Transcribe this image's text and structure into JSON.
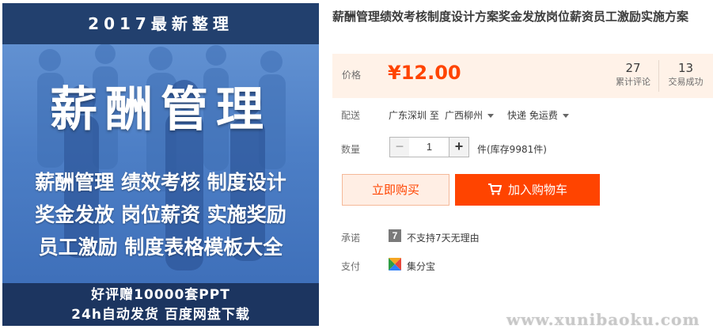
{
  "image": {
    "top_banner": "2017最新整理",
    "main_title": "薪酬管理",
    "lines": [
      "薪酬管理 绩效考核 制度设计",
      "奖金发放 岗位薪资 实施奖励",
      "员工激励 制度表格模板大全"
    ],
    "bottom_line1": "好评赠10000套PPT",
    "bottom_line2": "24h自动发货 百度网盘下载"
  },
  "product": {
    "title": "薪酬管理绩效考核制度设计方案奖金发放岗位薪资员工激励实施方案"
  },
  "price": {
    "label": "价格",
    "value": "¥12.00",
    "reviews_count": "27",
    "reviews_label": "累计评论",
    "deals_count": "13",
    "deals_label": "交易成功"
  },
  "delivery": {
    "label": "配送",
    "from": "广东深圳 至",
    "to": "广西柳州",
    "shipping": "快递 免运费"
  },
  "quantity": {
    "label": "数量",
    "minus": "−",
    "value": "1",
    "plus": "+",
    "stock": "件(库存9981件)"
  },
  "actions": {
    "buy_now": "立即购买",
    "add_to_cart": "加入购物车"
  },
  "promise": {
    "label": "承诺",
    "icon_text": "7",
    "text": "不支持7天无理由"
  },
  "payment": {
    "label": "支付",
    "text": "集分宝"
  },
  "watermark": "www.xunibaoku.com",
  "colors": {
    "accent": "#ff4400",
    "price_bg": "#fff2e8",
    "image_dark": "#22406e"
  }
}
